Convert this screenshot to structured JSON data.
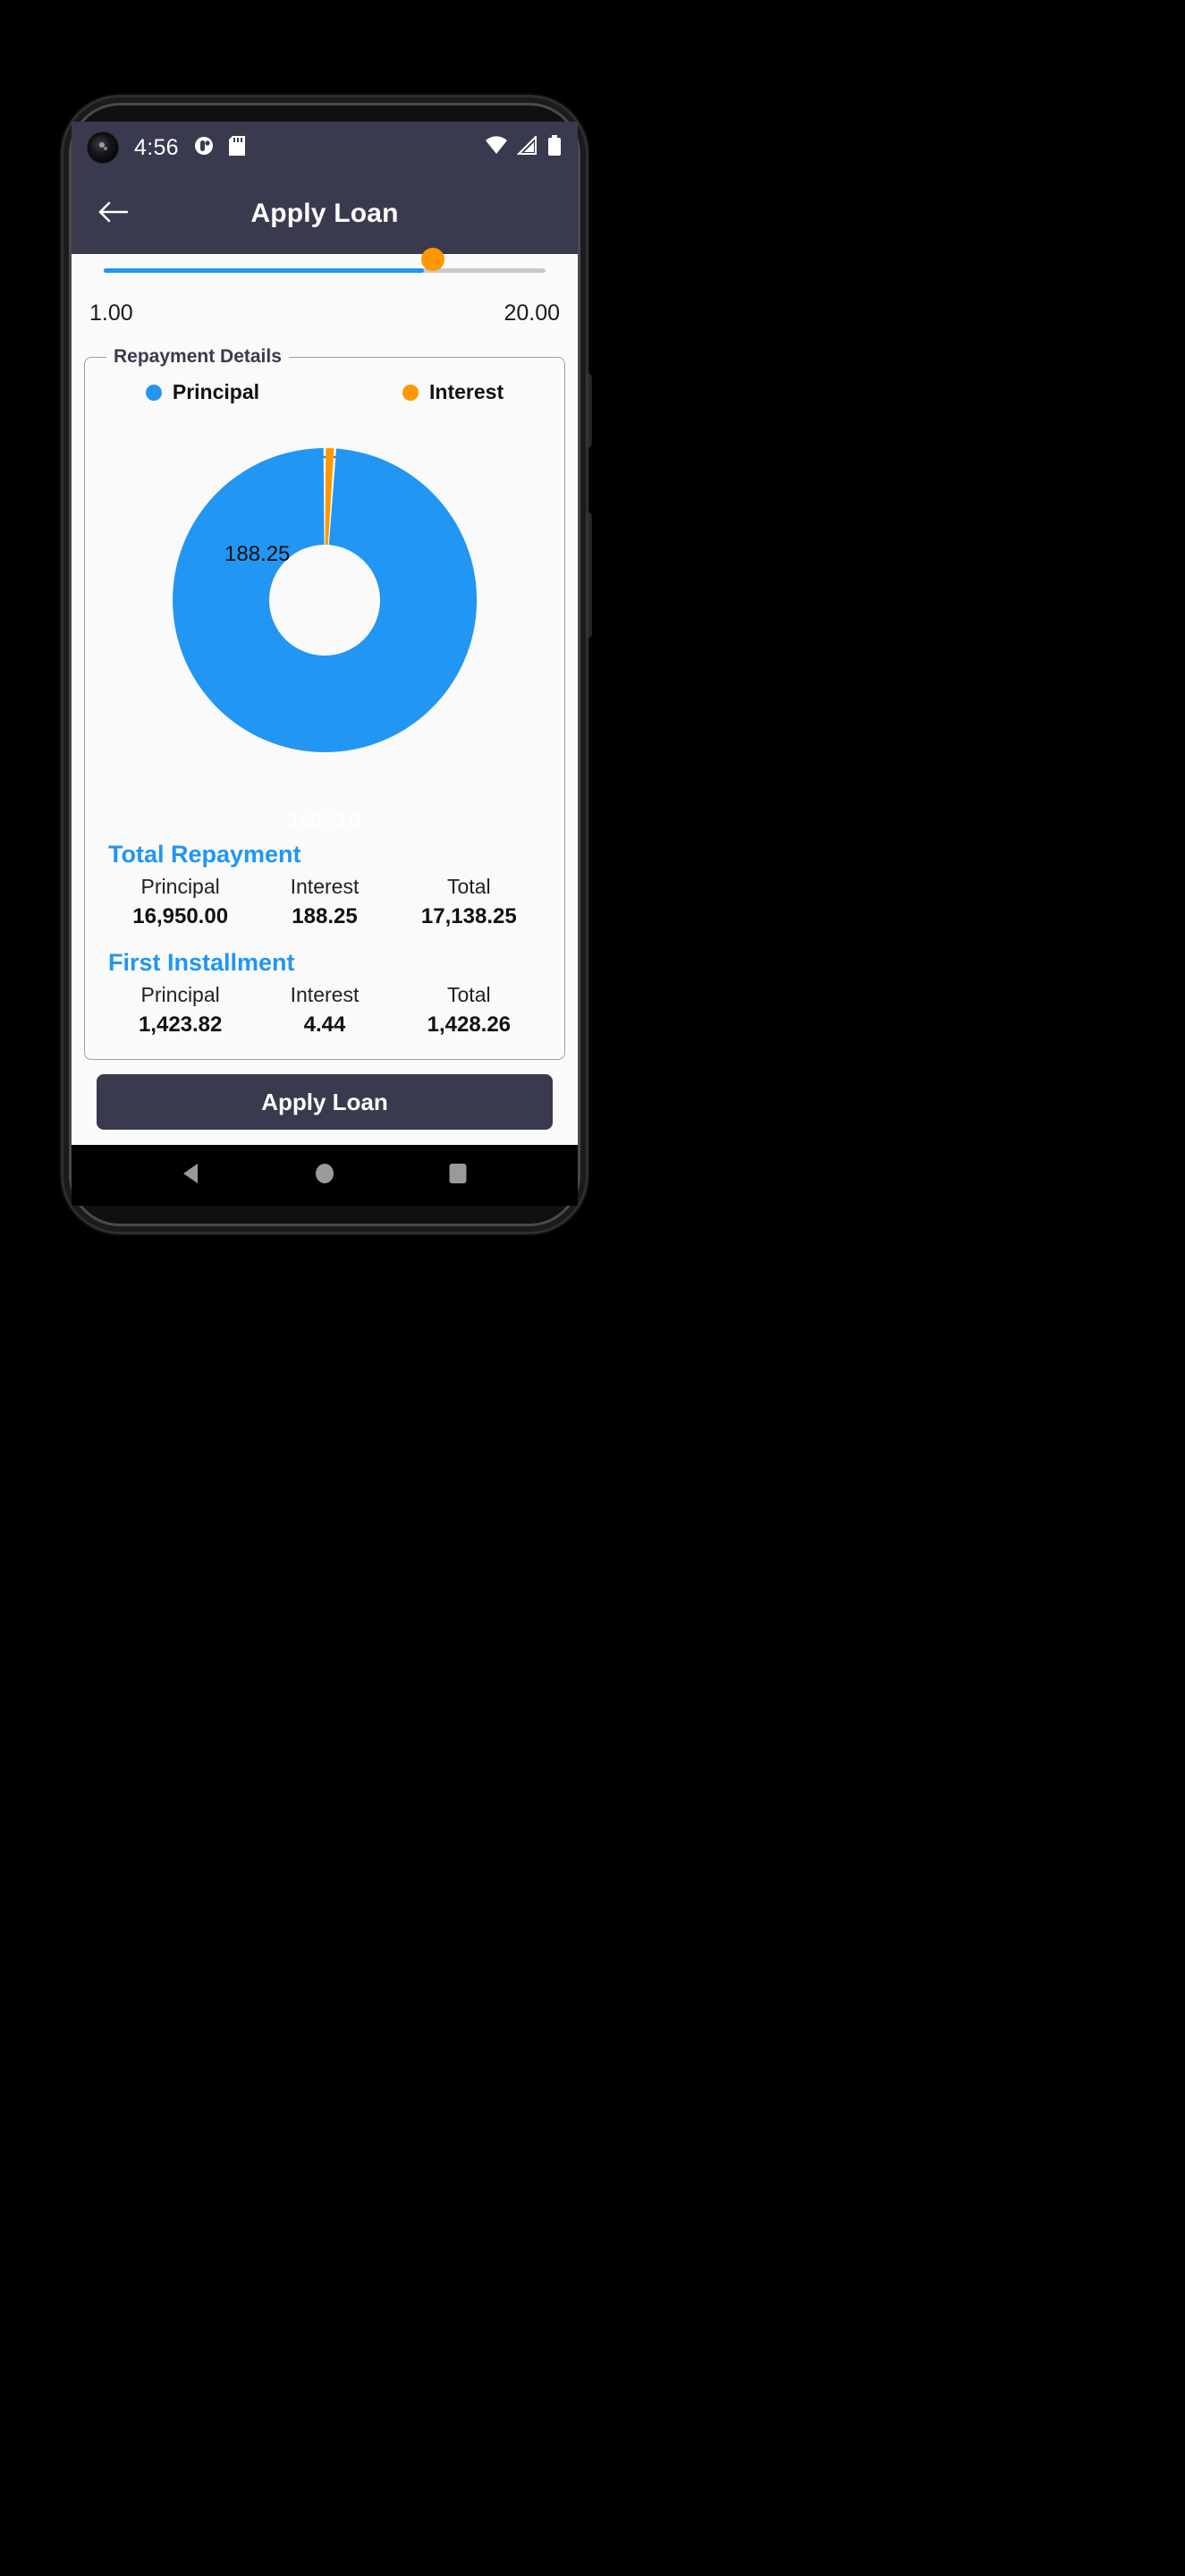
{
  "status_bar": {
    "time": "4:56",
    "left_icons": [
      "camera-punch-hole",
      "do-not-disturb-icon",
      "sd-card-icon"
    ],
    "right_icons": [
      "wifi-icon",
      "cellular-signal-icon",
      "battery-icon"
    ]
  },
  "app_bar": {
    "title": "Apply Loan",
    "back_icon": "arrow-left-icon"
  },
  "slider": {
    "min_label": "1.00",
    "max_label": "20.00",
    "value_fraction": 0.725,
    "track_color": "#c9c9c9",
    "fill_color": "#2196f3",
    "thumb_color": "#ff9800"
  },
  "repayment_card": {
    "legend": "Repayment Details"
  },
  "chart_data": {
    "type": "pie",
    "title": "Repayment Details",
    "donut": true,
    "categories": [
      "Principal",
      "Interest"
    ],
    "values": [
      16950.0,
      188.25
    ],
    "data_labels": [
      "16950.0",
      "188.25"
    ],
    "colors": [
      "#2196f3",
      "#ff9800"
    ],
    "legend": [
      "Principal",
      "Interest"
    ],
    "legend_position": "top",
    "total": 17138.25,
    "grid": false,
    "xlabel": "",
    "ylabel": ""
  },
  "total_repayment": {
    "title": "Total Repayment",
    "headers": [
      "Principal",
      "Interest",
      "Total"
    ],
    "values": [
      "16,950.00",
      "188.25",
      "17,138.25"
    ]
  },
  "first_installment": {
    "title": "First Installment",
    "headers": [
      "Principal",
      "Interest",
      "Total"
    ],
    "values": [
      "1,423.82",
      "4.44",
      "1,428.26"
    ]
  },
  "apply_button": {
    "label": "Apply Loan"
  },
  "nav_bar": {
    "back": "nav-back-icon",
    "home": "nav-home-icon",
    "recents": "nav-recents-icon"
  },
  "colors": {
    "app_bar": "#3a3a4f",
    "accent_blue": "#2196f3",
    "accent_orange": "#ff9800"
  }
}
